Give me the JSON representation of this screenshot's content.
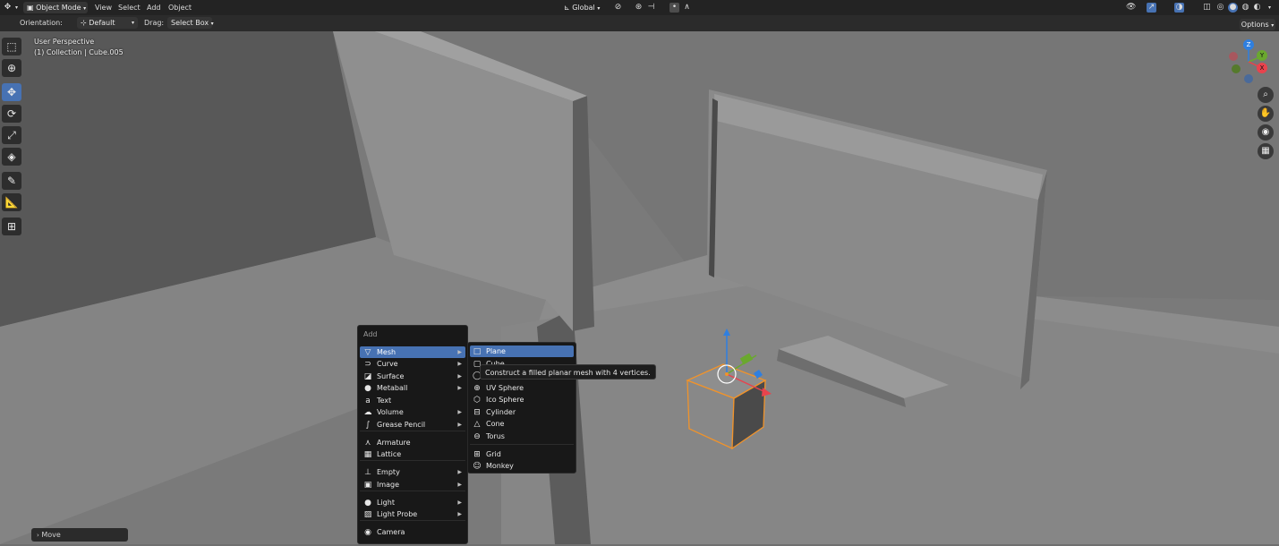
{
  "header": {
    "mode": "Object Mode",
    "menus": [
      "View",
      "Select",
      "Add",
      "Object"
    ],
    "transform_orientation": "Global"
  },
  "toolsettings": {
    "orientation_label": "Orientation:",
    "orientation_value": "Default",
    "drag_label": "Drag:",
    "drag_value": "Select Box",
    "options": "Options"
  },
  "overlay": {
    "view_name": "User Perspective",
    "collection": "(1) Collection | Cube.005"
  },
  "gizmo": {
    "z": "Z",
    "y": "Y",
    "x": "X"
  },
  "last_operator": "Move",
  "add_menu": {
    "title": "Add",
    "items": [
      {
        "label": "Mesh",
        "icon": "mesh-icon",
        "glyph": "▽",
        "sub": true,
        "highlight": true
      },
      {
        "label": "Curve",
        "icon": "curve-icon",
        "glyph": "⊃",
        "sub": true
      },
      {
        "label": "Surface",
        "icon": "surface-icon",
        "glyph": "◪",
        "sub": true
      },
      {
        "label": "Metaball",
        "icon": "metaball-icon",
        "glyph": "●",
        "sub": true
      },
      {
        "label": "Text",
        "icon": "text-icon",
        "glyph": "a",
        "sub": false
      },
      {
        "label": "Volume",
        "icon": "volume-icon",
        "glyph": "☁",
        "sub": true
      },
      {
        "label": "Grease Pencil",
        "icon": "grease-pencil-icon",
        "glyph": "∫",
        "sub": true
      },
      {
        "label": "Armature",
        "icon": "armature-icon",
        "glyph": "⋏",
        "sub": false
      },
      {
        "label": "Lattice",
        "icon": "lattice-icon",
        "glyph": "▦",
        "sub": false
      },
      {
        "label": "Empty",
        "icon": "empty-icon",
        "glyph": "⊥",
        "sub": true
      },
      {
        "label": "Image",
        "icon": "image-icon",
        "glyph": "▣",
        "sub": true
      },
      {
        "label": "Light",
        "icon": "light-icon",
        "glyph": "●",
        "sub": true
      },
      {
        "label": "Light Probe",
        "icon": "light-probe-icon",
        "glyph": "▨",
        "sub": true
      },
      {
        "label": "Camera",
        "icon": "camera-icon",
        "glyph": "◉",
        "sub": false
      }
    ]
  },
  "mesh_menu": {
    "items": [
      {
        "label": "Plane",
        "icon": "plane-icon",
        "glyph": "□",
        "highlight": true
      },
      {
        "label": "Cube",
        "icon": "cube-icon",
        "glyph": "▢"
      },
      {
        "label": "Circle",
        "icon": "circle-icon",
        "glyph": "◯"
      },
      {
        "label": "UV Sphere",
        "icon": "uv-sphere-icon",
        "glyph": "⊕"
      },
      {
        "label": "Ico Sphere",
        "icon": "ico-sphere-icon",
        "glyph": "⬡"
      },
      {
        "label": "Cylinder",
        "icon": "cylinder-icon",
        "glyph": "⊟"
      },
      {
        "label": "Cone",
        "icon": "cone-icon",
        "glyph": "△"
      },
      {
        "label": "Torus",
        "icon": "torus-icon",
        "glyph": "⊖"
      },
      {
        "label": "Grid",
        "icon": "grid-icon",
        "glyph": "⊞"
      },
      {
        "label": "Monkey",
        "icon": "monkey-icon",
        "glyph": "☺"
      }
    ]
  },
  "tooltip": "Construct a filled planar mesh with 4 vertices.",
  "colors": {
    "accent": "#4772b3",
    "selection": "#f0932b",
    "axis_x": "#e8434d",
    "axis_y": "#6aa82e",
    "axis_z": "#2f7fe0"
  }
}
